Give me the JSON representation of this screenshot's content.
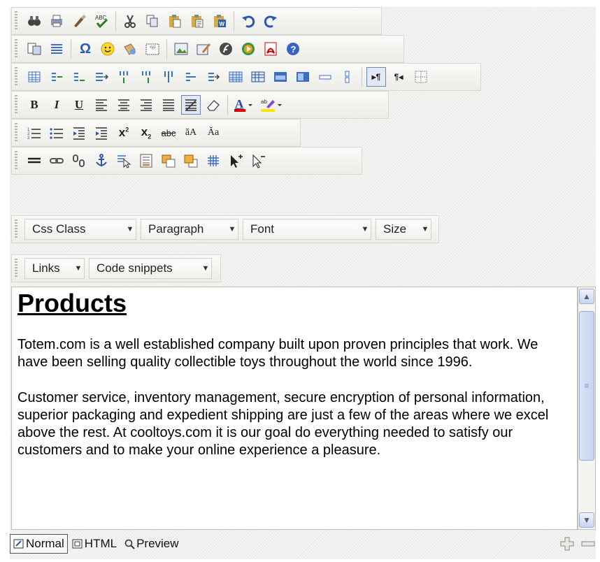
{
  "toolbars": {
    "row1": {
      "buttons": [
        "find-icon",
        "print-icon",
        "paste-plain-icon",
        "spellcheck-icon",
        "cut-icon",
        "copy-icon",
        "paste-icon",
        "paste-text-icon",
        "paste-word-icon",
        "undo-icon",
        "redo-icon"
      ]
    },
    "row2": {
      "buttons": [
        "template-icon",
        "hr-list-icon",
        "special-char-icon",
        "smiley-icon",
        "insert-image-rights-icon",
        "text-box-icon",
        "image-icon",
        "image-edit-icon",
        "flash-icon",
        "media-icon",
        "pdf-icon",
        "help-icon"
      ]
    },
    "row3": {
      "buttons": [
        "insert-table-icon",
        "row-above-icon",
        "row-below-icon",
        "delete-row-icon",
        "col-left-icon",
        "col-right-icon",
        "delete-col-icon",
        "merge-row-icon",
        "split-row-icon",
        "table-grid-icon",
        "table-props-icon",
        "cell-props-icon",
        "table-style-icon",
        "merge-cells-icon",
        "split-cells-icon",
        "ltr-icon",
        "rtl-icon",
        "table-border-icon"
      ]
    },
    "row4": {
      "bold": "B",
      "italic": "I",
      "underline": "U"
    },
    "row5": {
      "buttons": [
        "ordered-list-icon",
        "unordered-list-icon",
        "outdent-icon",
        "indent-icon",
        "superscript-icon",
        "subscript-icon",
        "strikethrough-icon",
        "lowercase-icon",
        "uppercase-icon"
      ]
    },
    "row6": {
      "buttons": [
        "hr-icon",
        "link-icon",
        "unlink-icon",
        "anchor-icon",
        "image-map-icon",
        "form-icon",
        "layer-front-icon",
        "layer-back-icon",
        "grid-icon",
        "absolute-pos-icon",
        "static-pos-icon"
      ]
    },
    "dropdowns1": {
      "css_class": "Css Class",
      "paragraph": "Paragraph",
      "font": "Font",
      "size": "Size"
    },
    "dropdowns2": {
      "links": "Links",
      "code_snippets": "Code snippets"
    }
  },
  "content": {
    "heading": "Products",
    "para1": "Totem.com is a well established company built upon proven principles that work. We have been selling quality collectible toys throughout the world since 1996.",
    "para2": "Customer service, inventory management, secure encryption of personal information, superior packaging and expedient shipping are just a few of the areas where we excel above the rest. At cooltoys.com it is our goal do everything needed to satisfy our customers and to make your online experience a pleasure."
  },
  "status": {
    "normal": "Normal",
    "html": "HTML",
    "preview": "Preview",
    "active_mode": "Normal"
  },
  "colors": {
    "font_color_bar": "#e00000",
    "highlight_color_bar": "#ffe600",
    "accent": "#6b84b4"
  }
}
